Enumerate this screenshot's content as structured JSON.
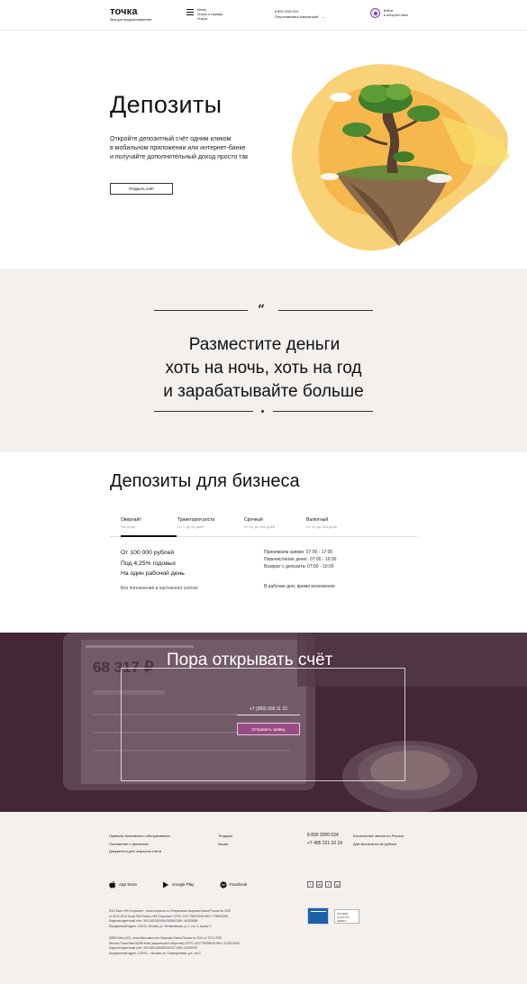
{
  "header": {
    "logo_name": "точка",
    "logo_tagline": "банк для предпринимателей",
    "menu_label": "Меню",
    "menu_sub1": "Услуги и тарифы",
    "menu_sub2": "Услуги",
    "phone": "8 800 2000 024",
    "city": "Петропавловск-Камчатский",
    "login_line1": "Войти",
    "login_line2": "в интернет-банк"
  },
  "hero": {
    "title": "Депозиты",
    "text_line1": "Откройте депозитный счёт одним кликом",
    "text_line2": "в мобильном приложении или интернет-банке",
    "text_line3": "и получайте дополнительный доход просто так",
    "button_label": "Открыть счёт"
  },
  "quote": {
    "mark": "“",
    "line1": "Разместите деньги",
    "line2": "хоть на ночь, хоть на год",
    "line3": "и зарабатывайте больше"
  },
  "deposits": {
    "title": "Депозиты для бизнеса",
    "tabs": [
      {
        "name": "Овернайт",
        "sub": "На сутки"
      },
      {
        "name": "Траектория роста",
        "sub": "От 2 до 44 дней"
      },
      {
        "name": "Срочный",
        "sub": "От 31 до 360 дней"
      },
      {
        "name": "Валютный",
        "sub": "От 31 до 360 дней"
      }
    ],
    "left_line1": "От 100 000 рублей",
    "left_line2": "Под 4,25% годовых",
    "left_line3": "На один рабочий день",
    "left_note": "Без пополнения и частичного снятия",
    "right_line1": "Принимаем заявки: 07:00 - 17:00",
    "right_line2": "Перечисление денег: 07:00 - 16:00",
    "right_line3": "Возврат с депозита: 07:00 - 10:00",
    "right_note": "В рабочие дни, время московское"
  },
  "cta": {
    "title": "Пора открывать счёт",
    "phone_value": "+7 (999) 000 11 22",
    "button_label": "Отправить заявку",
    "tablet_amount": "68 317 ₽"
  },
  "footer": {
    "col1": [
      "Правила банковского обслуживания",
      "Положение о финансах",
      "Документы для открытия счёта"
    ],
    "col2": [
      "Тендеры",
      "Акции"
    ],
    "phone1": "8 800 2000 024",
    "phone2": "+7 495 221 32 24",
    "phone1_desc": "Бесплатный звонок по России",
    "phone2_desc": "Для звонков из-за рубежа",
    "stores": [
      "App Store",
      "Google Play",
      "Facebook"
    ],
    "socials": [
      "f",
      "vk",
      "t",
      "g"
    ],
    "legal1": [
      "ПАО Банк «ФК Открытие», точка.открытие.ru Генеральная лицензия Банка России № 2209",
      "от 26.11.2014 Точка ПАО Банка «ФК Открытие» ОГРН: 1027739019208 ИНН: 7706092528",
      "Корреспондентский счёт: 30101810300000000985 БИК: 044525985",
      "Юридический адрес: 115114, Москва, ул. Летниковская, д. 2, стр. 4, корпус 2"
    ],
    "legal2": [
      "КИВИ Банк (АО), точка.банк.киви.com Лицензия Банка России № 2241 от 20.01.2015",
      "Филиал Точка Банк КИВИ Банк (акционерное общество) ОГРН: 1027739328440 ИНН: 3123011520",
      "Корреспондентский счёт: 30101810445250000797 БИК: 044525797",
      "Юридический адрес: 123001, г. Москва, ул. Спиридоновка, д.4, стр.2"
    ],
    "badge2_line1": "ISO 9001",
    "badge2_line2": "CLICK TO VERIFY"
  }
}
